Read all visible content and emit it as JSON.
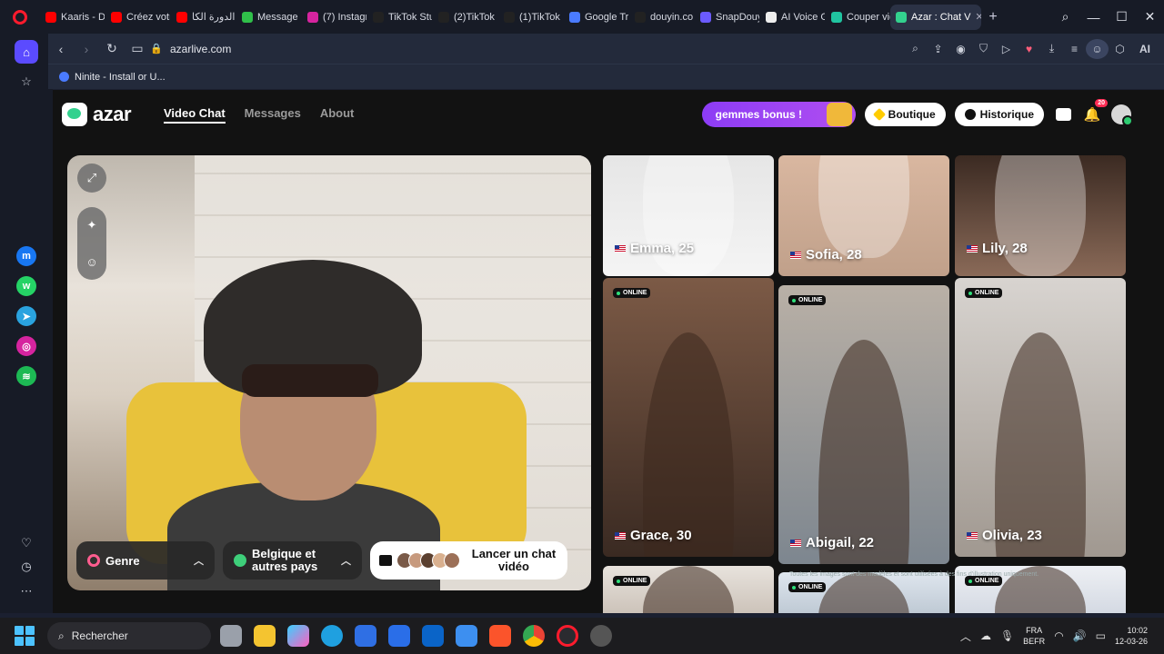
{
  "browser": {
    "tabs": [
      {
        "label": "Kaaris - De",
        "color": "#ff0000"
      },
      {
        "label": "Créez votr",
        "color": "#ff0000"
      },
      {
        "label": "الدورة الكا",
        "color": "#ff0000"
      },
      {
        "label": "Message M",
        "color": "#30c04a"
      },
      {
        "label": "(7) Instagr",
        "color": "#d6249f"
      },
      {
        "label": "TikTok Stu",
        "color": "#222222"
      },
      {
        "label": "(2)TikTok",
        "color": "#222222"
      },
      {
        "label": "(1)TikTok",
        "color": "#222222"
      },
      {
        "label": "Google Tra",
        "color": "#4a7bff"
      },
      {
        "label": "douyin.co",
        "color": "#222222"
      },
      {
        "label": "SnapDouy",
        "color": "#6b5bff"
      },
      {
        "label": "AI Voice G",
        "color": "#eeeeee"
      },
      {
        "label": "Couper vid",
        "color": "#20c4a0"
      }
    ],
    "active_tab": {
      "label": "Azar : Chat V",
      "color": "#33d18e"
    },
    "url": "azarlive.com",
    "bookmark": "Ninite - Install or U...",
    "ai_label": "AI",
    "sidebar_icons": [
      "home-icon",
      "star-icon",
      "messenger-icon",
      "whatsapp-icon",
      "telegram-icon",
      "instagram-icon",
      "spotify-icon",
      "heart-icon",
      "history-icon",
      "more-icon"
    ]
  },
  "azar": {
    "logo_text": "azar",
    "nav": [
      "Video Chat",
      "Messages",
      "About"
    ],
    "gem_bonus": "gemmes bonus !",
    "boutique": "Boutique",
    "historique": "Historique",
    "notification_count": "20"
  },
  "video": {
    "genre_label": "Genre",
    "region_label": "Belgique et autres pays",
    "launch_label": "Lancer un chat vidéo"
  },
  "profiles": [
    {
      "name": "Emma, 25",
      "online": false
    },
    {
      "name": "Sofia, 28",
      "online": false
    },
    {
      "name": "Lily, 28",
      "online": false
    },
    {
      "name": "Grace, 30",
      "online": true
    },
    {
      "name": "Abigail, 22",
      "online": true
    },
    {
      "name": "Olivia, 23",
      "online": true
    },
    {
      "name": "",
      "online": true
    },
    {
      "name": "",
      "online": true
    },
    {
      "name": "",
      "online": true
    }
  ],
  "online_label": "ONLINE",
  "notice": "Toutes les images sont des modèles et sont utilisées à des fins d'illustration uniquement.",
  "taskbar": {
    "search_placeholder": "Rechercher",
    "lang_top": "FRA",
    "lang_bottom": "BEFR",
    "time": "10:02",
    "date": "12-03-26"
  }
}
